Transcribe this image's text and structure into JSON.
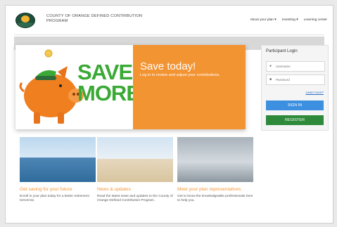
{
  "header": {
    "org_line1": "COUNTY OF ORANGE DEFINED CONTRIBUTION",
    "org_line2": "PROGRAM",
    "nav": [
      "About your plan ▾",
      "Investing ▾",
      "Learning center"
    ]
  },
  "hero": {
    "save_line1": "SAVE",
    "save_line2": "MORE",
    "title": "Save today!",
    "subtitle": "Log in to review and adjust your contributions."
  },
  "login": {
    "title": "Participant Login",
    "username_placeholder": "Username",
    "password_placeholder": "Password",
    "learn_more": "Learn more?",
    "signin_label": "SIGN IN",
    "register_label": "REGISTER"
  },
  "cards": [
    {
      "title": "Get saving for your future",
      "text": "Enroll in your plan today for a better retirement tomorrow."
    },
    {
      "title": "News & updates",
      "text": "Read the latest news and updates to the County of Orange Defined Contribution Program."
    },
    {
      "title": "Meet your plan representatives",
      "text": "Get to know the knowledgeable professionals here to help you."
    }
  ],
  "colors": {
    "accent_orange": "#f39433",
    "signin_blue": "#3d8fe0",
    "register_green": "#2e8a3a",
    "save_green": "#3aa935"
  }
}
